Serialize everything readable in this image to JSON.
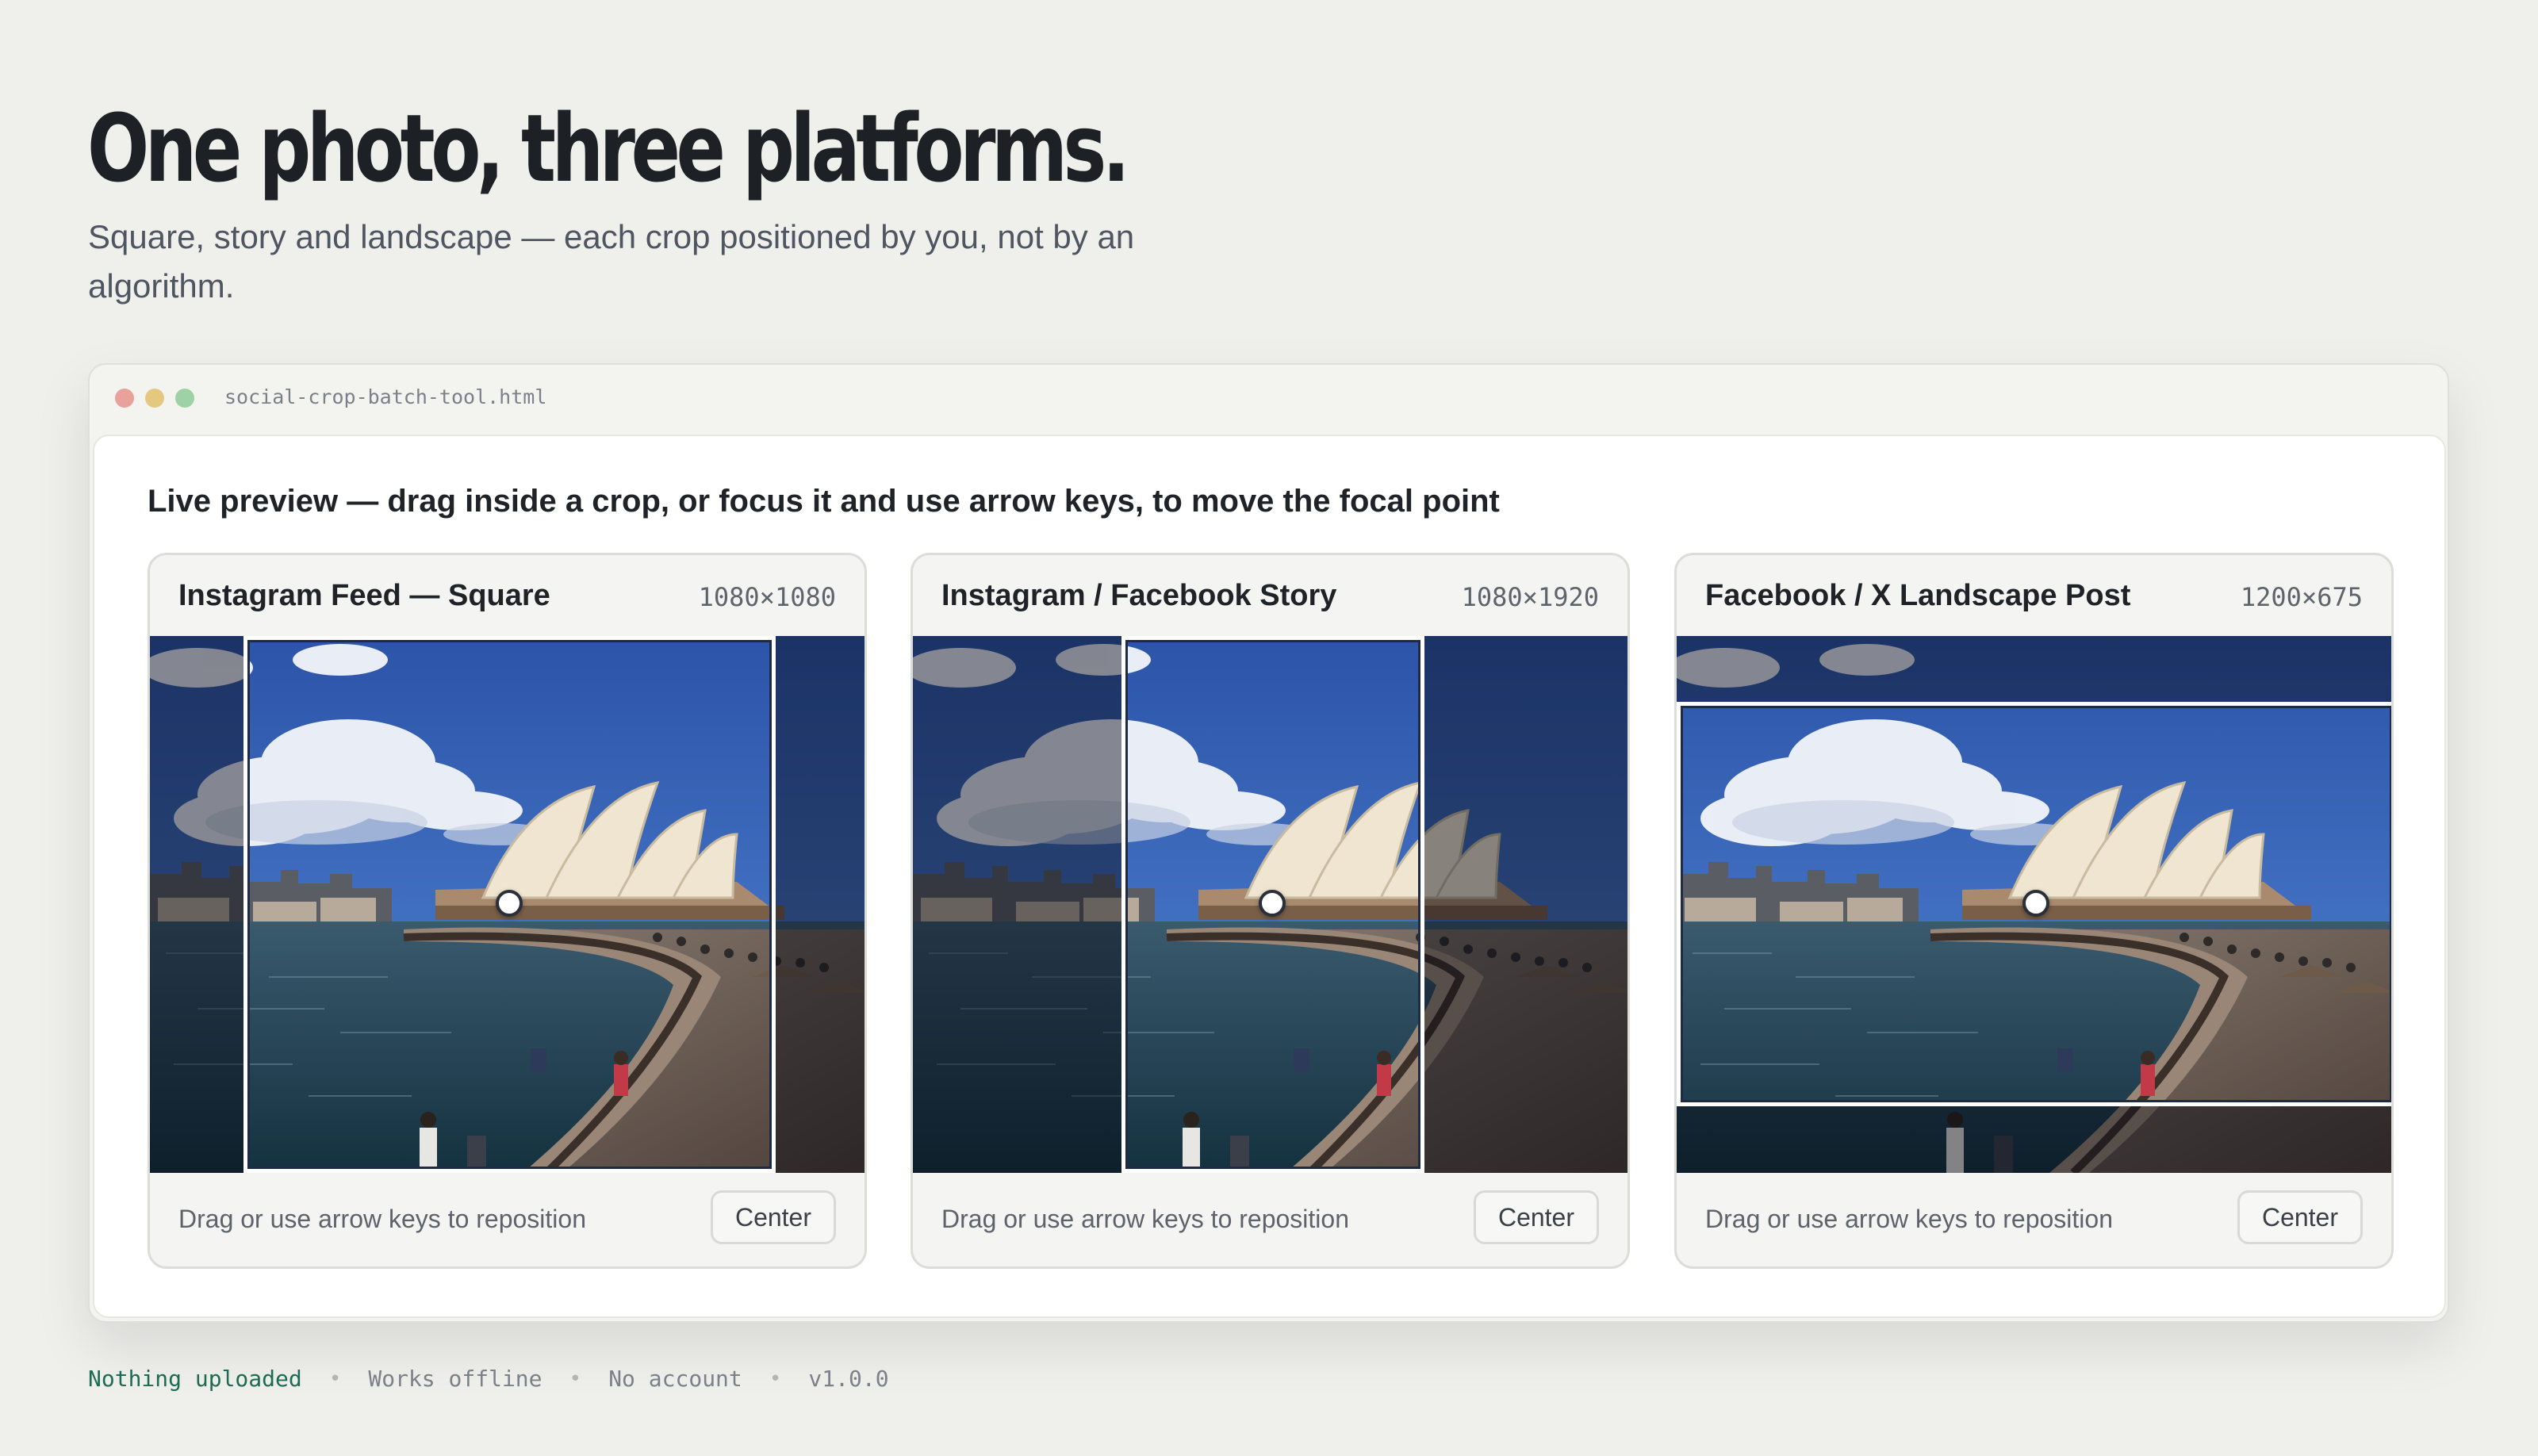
{
  "hero": {
    "title": "One photo, three platforms.",
    "subtitle": "Square, story and landscape — each crop positioned by you, not by an algorithm."
  },
  "window": {
    "filename": "social-crop-batch-tool.html"
  },
  "panel": {
    "heading": "Live preview — drag inside a crop, or focus it and use arrow keys, to move the focal point"
  },
  "cards": [
    {
      "title": "Instagram Feed — Square",
      "size": "1080×1080",
      "hint": "Drag or use arrow keys to reposition",
      "button": "Center"
    },
    {
      "title": "Instagram / Facebook Story",
      "size": "1080×1920",
      "hint": "Drag or use arrow keys to reposition",
      "button": "Center"
    },
    {
      "title": "Facebook / X Landscape Post",
      "size": "1200×675",
      "hint": "Drag or use arrow keys to reposition",
      "button": "Center"
    }
  ],
  "footer": {
    "privacy": "Nothing uploaded",
    "offline": "Works offline",
    "account": "No account",
    "version": "v1.0.0"
  },
  "colors": {
    "accent": "#1d6a55",
    "background": "#eff0ec",
    "sky": "#3a62b4"
  }
}
